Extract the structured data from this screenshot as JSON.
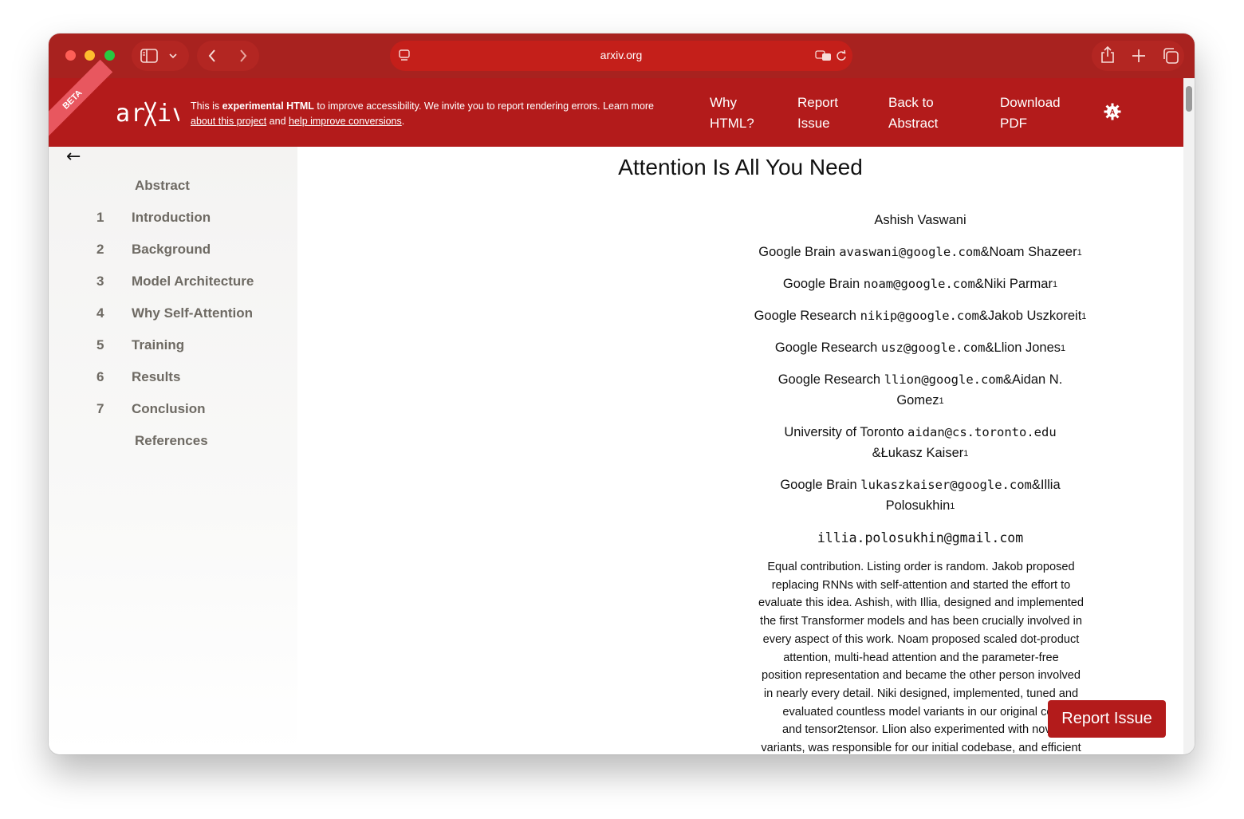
{
  "browser": {
    "address": "arxiv.org",
    "icons": [
      "sidebar-icon",
      "chevron-down-icon",
      "back-icon",
      "forward-icon",
      "page-icon",
      "translate-icon",
      "reload-icon",
      "share-icon",
      "new-tab-icon",
      "tabs-icon"
    ]
  },
  "header": {
    "beta": "BETA",
    "logo": "arXiv",
    "notice_prefix": "This is ",
    "notice_bold": "experimental HTML",
    "notice_mid": " to improve accessibility. We invite you to report rendering errors. Learn more",
    "notice_link1": "about this project",
    "notice_and": " and ",
    "notice_link2": "help improve conversions",
    "notice_end": ".",
    "nav": {
      "why_1": "Why",
      "why_2": "HTML?",
      "report_1": "Report",
      "report_2": "Issue",
      "back_1": "Back to",
      "back_2": "Abstract",
      "download_1": "Download",
      "download_2": "PDF"
    },
    "colors": {
      "accent": "#b31b1b",
      "toolbar": "#a8221f"
    }
  },
  "toc": {
    "back": "←",
    "items": [
      {
        "num": "",
        "label": "Abstract"
      },
      {
        "num": "1",
        "label": "Introduction"
      },
      {
        "num": "2",
        "label": "Background"
      },
      {
        "num": "3",
        "label": "Model Architecture"
      },
      {
        "num": "4",
        "label": "Why Self-Attention"
      },
      {
        "num": "5",
        "label": "Training"
      },
      {
        "num": "6",
        "label": "Results"
      },
      {
        "num": "7",
        "label": "Conclusion"
      },
      {
        "num": "",
        "label": "References"
      }
    ]
  },
  "paper": {
    "title": "Attention Is All You Need",
    "authors": {
      "a1": "Ashish Vaswani",
      "l2_aff": "Google Brain ",
      "l2_email": "avaswani@google.com",
      "l2_next": "&Noam Shazeer",
      "l3_aff": "Google Brain ",
      "l3_email": "noam@google.com",
      "l3_next": "&Niki Parmar",
      "l4_aff": "Google Research ",
      "l4_email": "nikip@google.com",
      "l4_next": "&Jakob Uszkoreit",
      "l5_aff": "Google Research ",
      "l5_email": "usz@google.com",
      "l5_next": "&Llion Jones",
      "l6_aff": "Google Research ",
      "l6_email": "llion@google.com",
      "l6_next": "&Aidan N.",
      "l6b": "Gomez",
      "l7_aff": "University of Toronto ",
      "l7_email": "aidan@cs.toronto.edu",
      "l7b": "&Łukasz Kaiser",
      "l8_aff": "Google Brain ",
      "l8_email": "lukaszkaiser@google.com",
      "l8_next": "&Illia",
      "l8b": "Polosukhin",
      "l9_email": "illia.polosukhin@gmail.com",
      "mark": "1"
    },
    "footnote": [
      "Equal contribution. Listing order is random. Jakob proposed",
      "replacing RNNs with self-attention and started the effort to",
      "evaluate this idea. Ashish, with Illia, designed and implemented",
      "the first Transformer models and has been crucially involved in",
      "every aspect of this work. Noam proposed scaled dot-product",
      "attention, multi-head attention and the parameter-free",
      "position representation and became the other person involved",
      "in nearly every detail. Niki designed, implemented, tuned and",
      "evaluated countless model variants in our original cod",
      "and tensor2tensor. Llion also experimented with novel",
      "variants, was responsible for our initial codebase, and efficient"
    ]
  },
  "report_button": "Report Issue"
}
